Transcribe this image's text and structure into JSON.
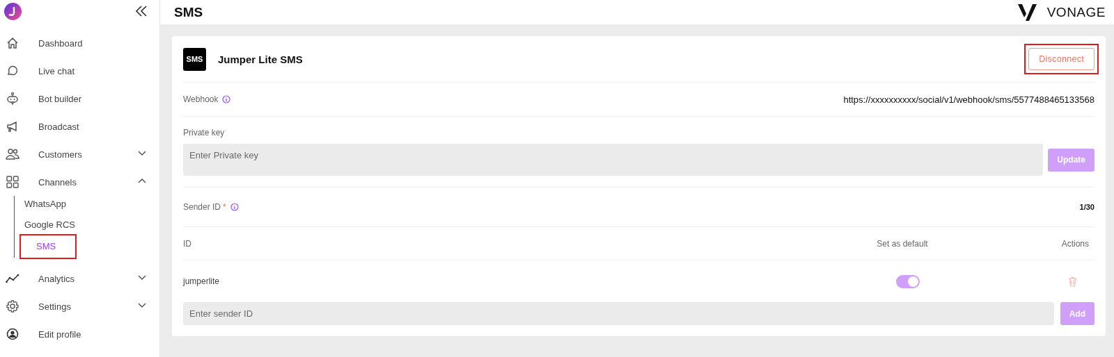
{
  "sidebar": {
    "items": [
      {
        "label": "Dashboard"
      },
      {
        "label": "Live chat"
      },
      {
        "label": "Bot builder"
      },
      {
        "label": "Broadcast"
      },
      {
        "label": "Customers",
        "expanded": false
      },
      {
        "label": "Channels",
        "expanded": true,
        "children": [
          {
            "label": "WhatsApp",
            "selected": false,
            "highlighted": false
          },
          {
            "label": "Google RCS",
            "selected": false,
            "highlighted": false
          },
          {
            "label": "SMS",
            "selected": true,
            "highlighted": true
          }
        ]
      },
      {
        "label": "Analytics",
        "expanded": false
      },
      {
        "label": "Settings",
        "expanded": false
      },
      {
        "label": "Edit profile"
      }
    ]
  },
  "header": {
    "title": "SMS",
    "brand": "VONAGE"
  },
  "card": {
    "badge": "SMS",
    "name": "Jumper Lite SMS",
    "disconnect": {
      "label": "Disconnect",
      "highlighted": true
    },
    "webhook": {
      "label": "Webhook",
      "value": "https://xxxxxxxxxx/social/v1/webhook/sms/5577488465133568"
    },
    "private_key": {
      "label": "Private key",
      "placeholder": "Enter Private key",
      "button": "Update"
    },
    "sender_id": {
      "label": "Sender ID",
      "required_mark": "*",
      "count": "1/30"
    },
    "table": {
      "columns": [
        "ID",
        "Set as default",
        "Actions"
      ],
      "rows": [
        {
          "id": "jumperlite",
          "default": true
        }
      ]
    },
    "new_sender": {
      "placeholder": "Enter sender ID",
      "button": "Add"
    }
  }
}
